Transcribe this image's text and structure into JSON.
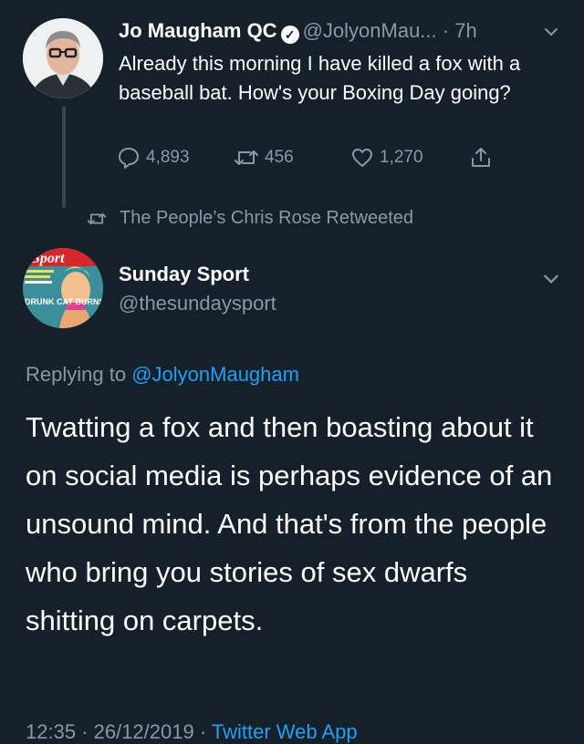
{
  "original_tweet": {
    "name": "Jo Maugham QC",
    "handle": "@JolyonMau...",
    "time": "· 7h",
    "text": "Already this morning I have killed a fox with a baseball bat. How's your Boxing Day going?",
    "stats": {
      "replies": "4,893",
      "retweets": "456",
      "likes": "1,270"
    }
  },
  "retweet_banner": "The People’s Chris Rose Retweeted",
  "reply_tweet": {
    "name": "Sunday Sport",
    "handle": "@thesundaysport",
    "replying_prefix": "Replying to",
    "replying_to": "@JolyonMaugham",
    "text": "Twatting a fox and then boasting about it on social media is perhaps evidence of an unsound mind. And that's from the people who bring you stories of sex dwarfs shitting on carpets.",
    "timestamp_prefix": "12:35 · 26/12/2019 · ",
    "source": "Twitter Web App",
    "avatar_text": {
      "masthead": "Sport",
      "headline": "DRUNK CAT BURNS"
    }
  },
  "colors": {
    "background": "#15202b",
    "text": "#ffffff",
    "muted": "#8899a6",
    "link": "#1da1f2",
    "divider": "#38444d"
  },
  "icons": [
    "verified-badge-icon",
    "chevron-down-icon",
    "reply-icon",
    "retweet-icon",
    "like-icon",
    "share-icon"
  ]
}
